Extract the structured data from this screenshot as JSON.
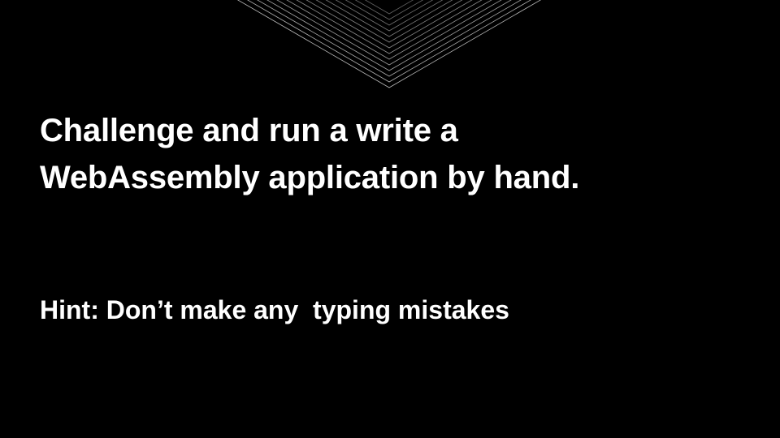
{
  "slide": {
    "title_lines": [
      "Challenge and run a write a",
      "WebAssembly application by hand."
    ],
    "hint": "Hint: Don’t make any  typing mistakes"
  },
  "colors": {
    "background": "#000000",
    "text": "#ffffff",
    "decoration_lines": "#d9d9d9"
  },
  "decoration": {
    "icon": "nested-chevron-lines"
  }
}
